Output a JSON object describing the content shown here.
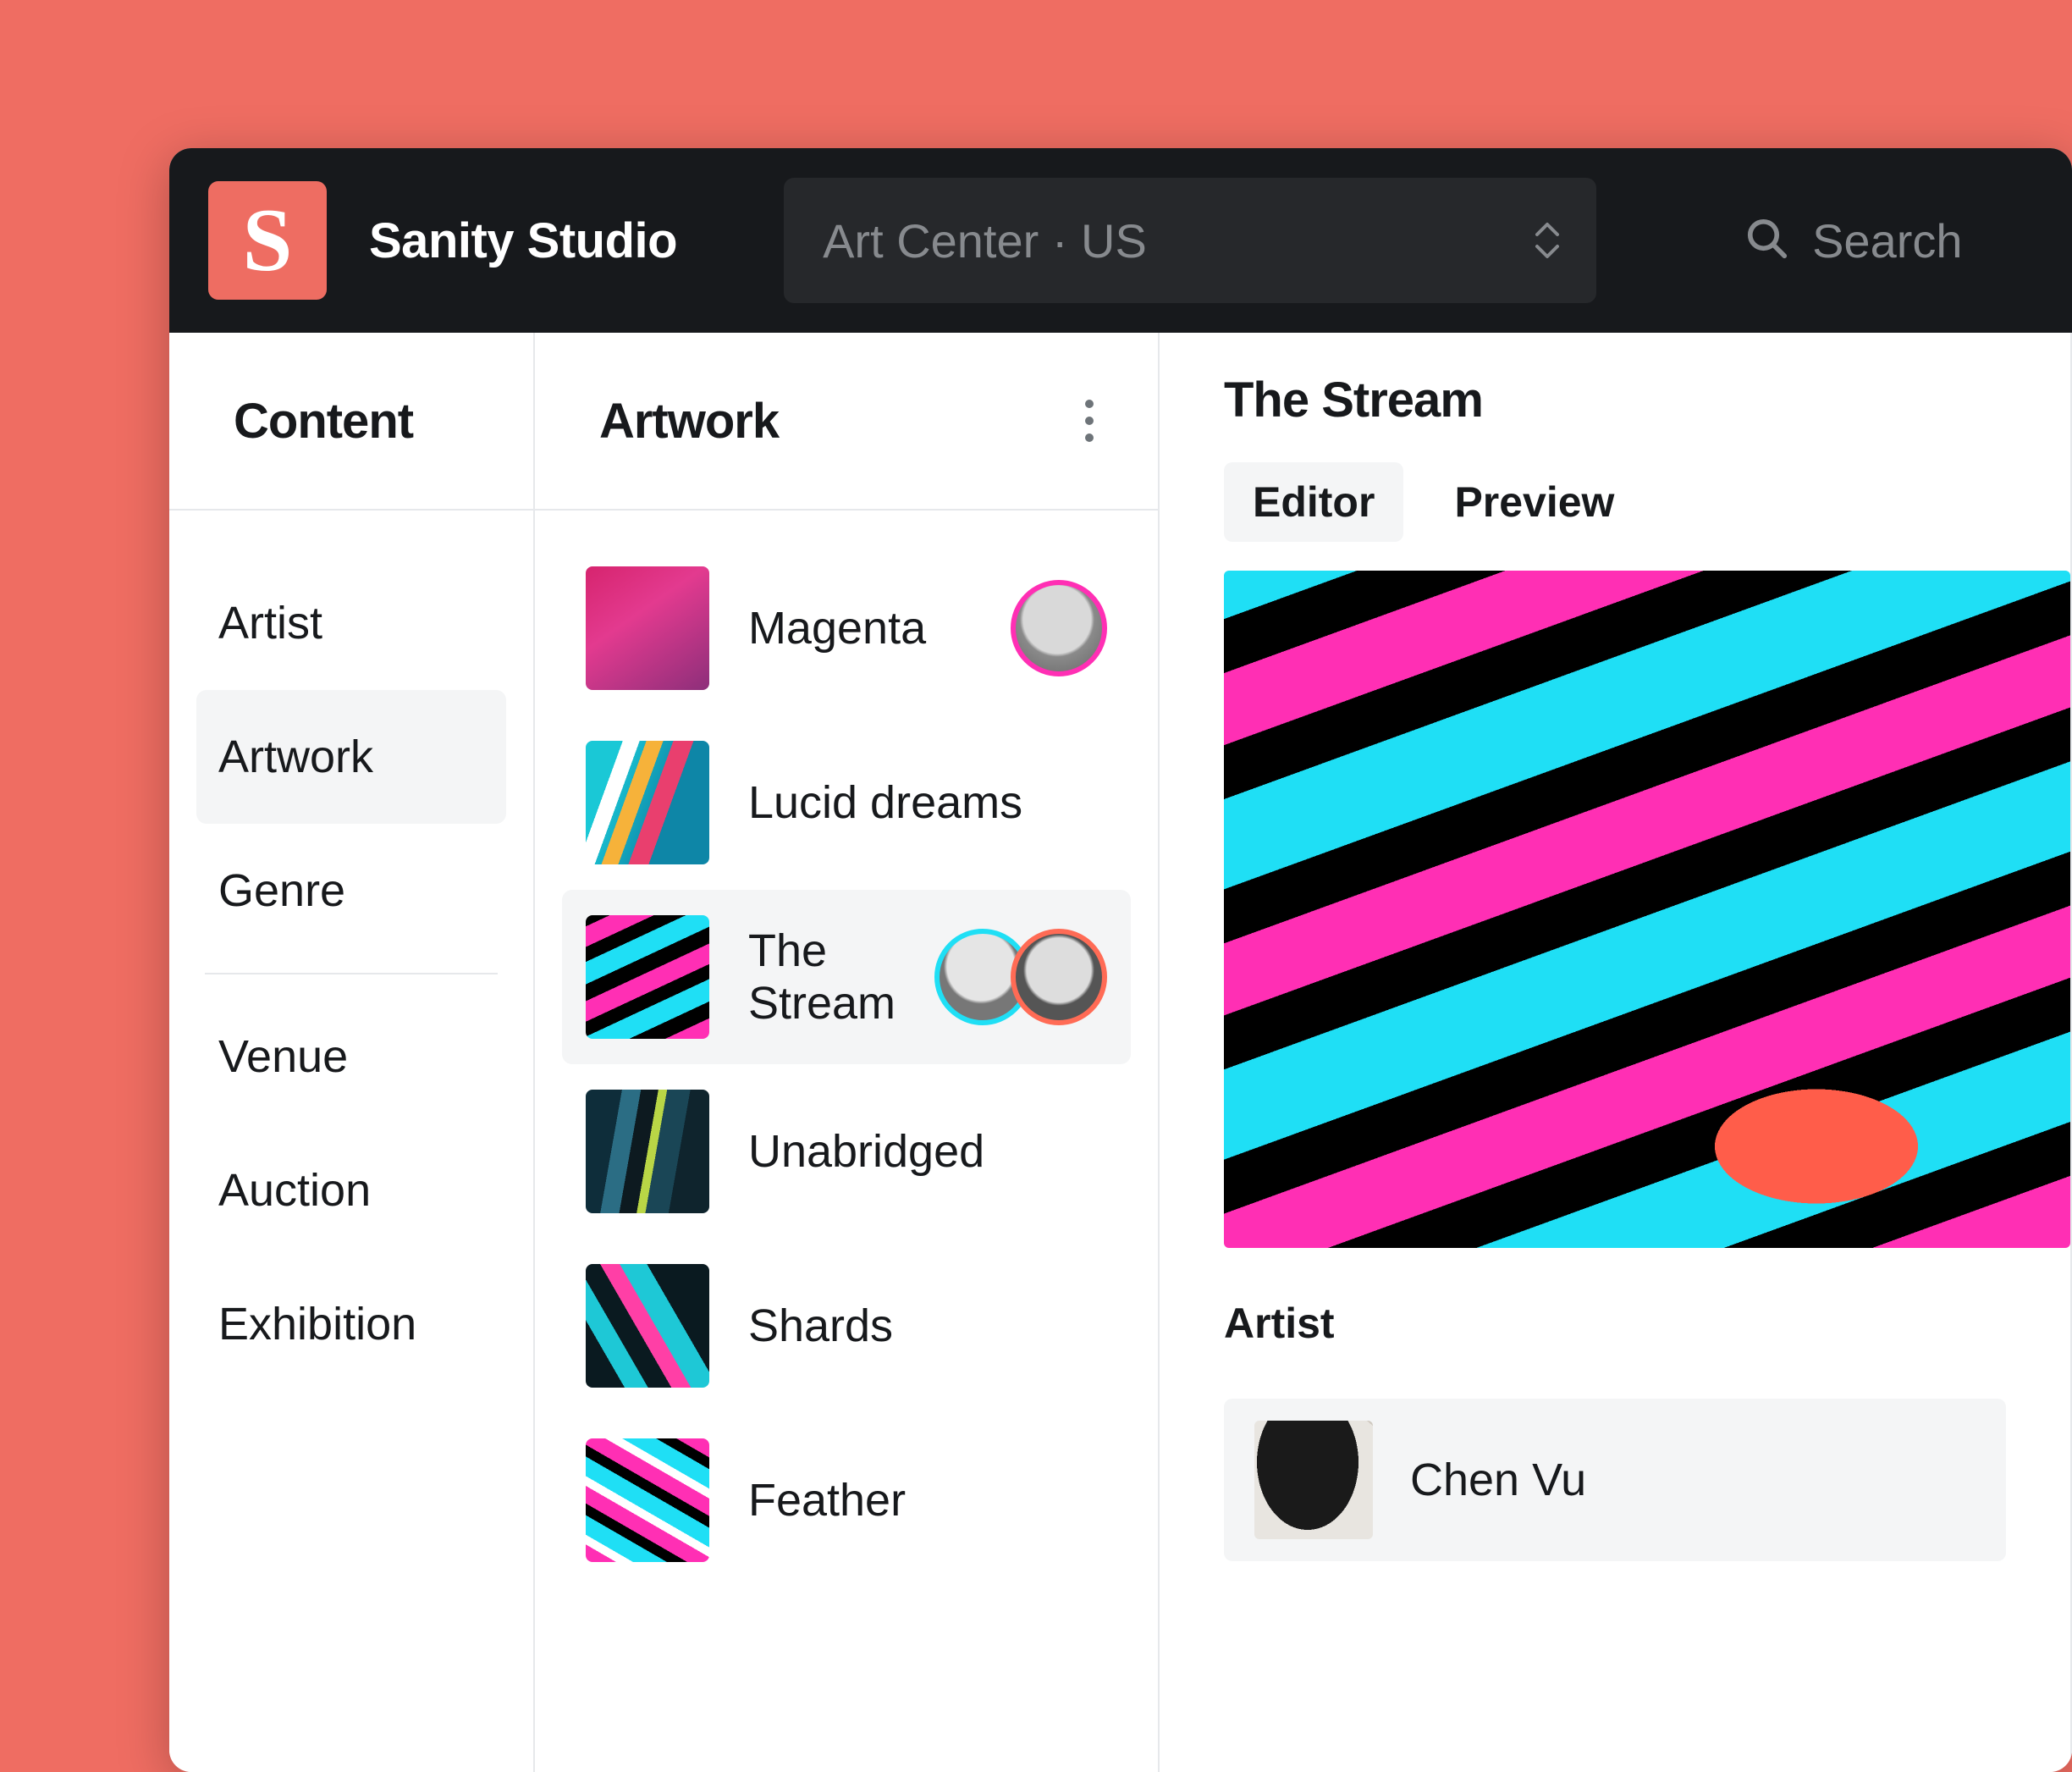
{
  "app_title": "Sanity Studio",
  "workspace": "Art Center · US",
  "search_placeholder": "Search",
  "sidebar": {
    "title": "Content",
    "items": [
      {
        "label": "Artist"
      },
      {
        "label": "Artwork"
      },
      {
        "label": "Genre"
      },
      {
        "label": "Venue"
      },
      {
        "label": "Auction"
      },
      {
        "label": "Exhibition"
      }
    ],
    "active_index": 1,
    "separator_after_index": 2
  },
  "list": {
    "title": "Artwork",
    "items": [
      {
        "label": "Magenta",
        "thumb": "sw-magenta",
        "avatars": [
          "avatar-pink"
        ]
      },
      {
        "label": "Lucid dreams",
        "thumb": "sw-lucid",
        "avatars": []
      },
      {
        "label": "The Stream",
        "thumb": "sw-stream",
        "avatars": [
          "avatar-cyan",
          "avatar-coral"
        ]
      },
      {
        "label": "Unabridged",
        "thumb": "sw-unabridged",
        "avatars": []
      },
      {
        "label": "Shards",
        "thumb": "sw-shards",
        "avatars": []
      },
      {
        "label": "Feather",
        "thumb": "sw-feather",
        "avatars": []
      }
    ],
    "active_index": 2
  },
  "detail": {
    "title": "The Stream",
    "tabs": [
      {
        "label": "Editor"
      },
      {
        "label": "Preview"
      }
    ],
    "active_tab": 0,
    "artist_section_label": "Artist",
    "artist_ref_name": "Chen Vu"
  }
}
